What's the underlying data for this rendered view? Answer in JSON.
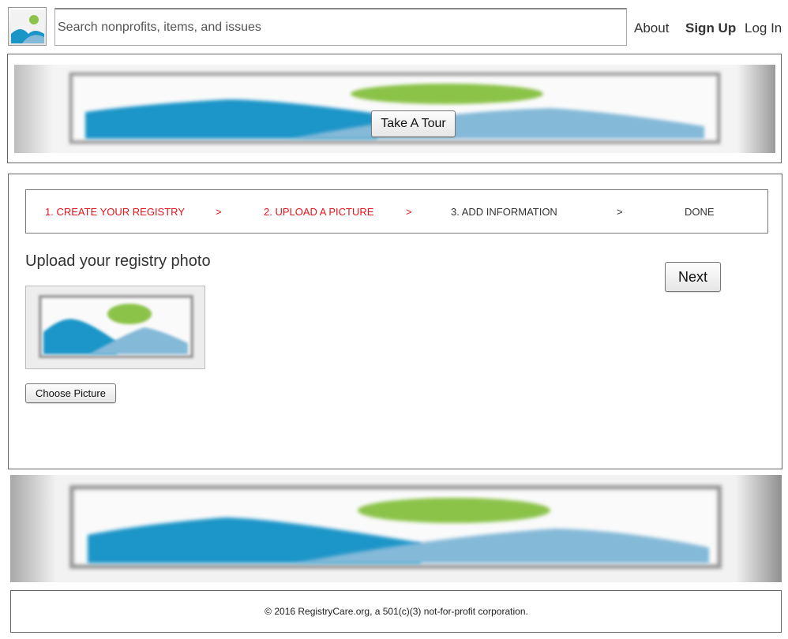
{
  "header": {
    "logo_icon": "image-placeholder-icon",
    "search_placeholder": "Search nonprofits, items, and issues",
    "nav": {
      "about": "About",
      "signup": "Sign Up",
      "login": "Log In"
    }
  },
  "top_banner": {
    "icon": "image-placeholder-icon",
    "tour_button": "Take A Tour"
  },
  "wizard": {
    "steps": [
      {
        "label": "1. CREATE YOUR REGISTRY",
        "state": "complete"
      },
      {
        "label": "2. UPLOAD A PICTURE",
        "state": "current"
      },
      {
        "label": "3. ADD INFORMATION",
        "state": "pending"
      },
      {
        "label": "DONE",
        "state": "pending"
      }
    ],
    "separators": [
      ">",
      ">",
      ">"
    ],
    "active_color": "#e0141c",
    "inactive_color": "#333333"
  },
  "upload": {
    "heading": "Upload your registry photo",
    "next_button": "Next",
    "thumbnail_icon": "image-placeholder-icon",
    "choose_button": "Choose Picture"
  },
  "bottom_banner": {
    "icon": "image-placeholder-icon"
  },
  "footer": {
    "text": "© 2016 RegistryCare.org, a 501(c)(3) not-for-profit corporation."
  },
  "colors": {
    "sky_blue": "#1a95c8",
    "light_blue": "#84b9d8",
    "sun_green": "#8bc34a"
  }
}
